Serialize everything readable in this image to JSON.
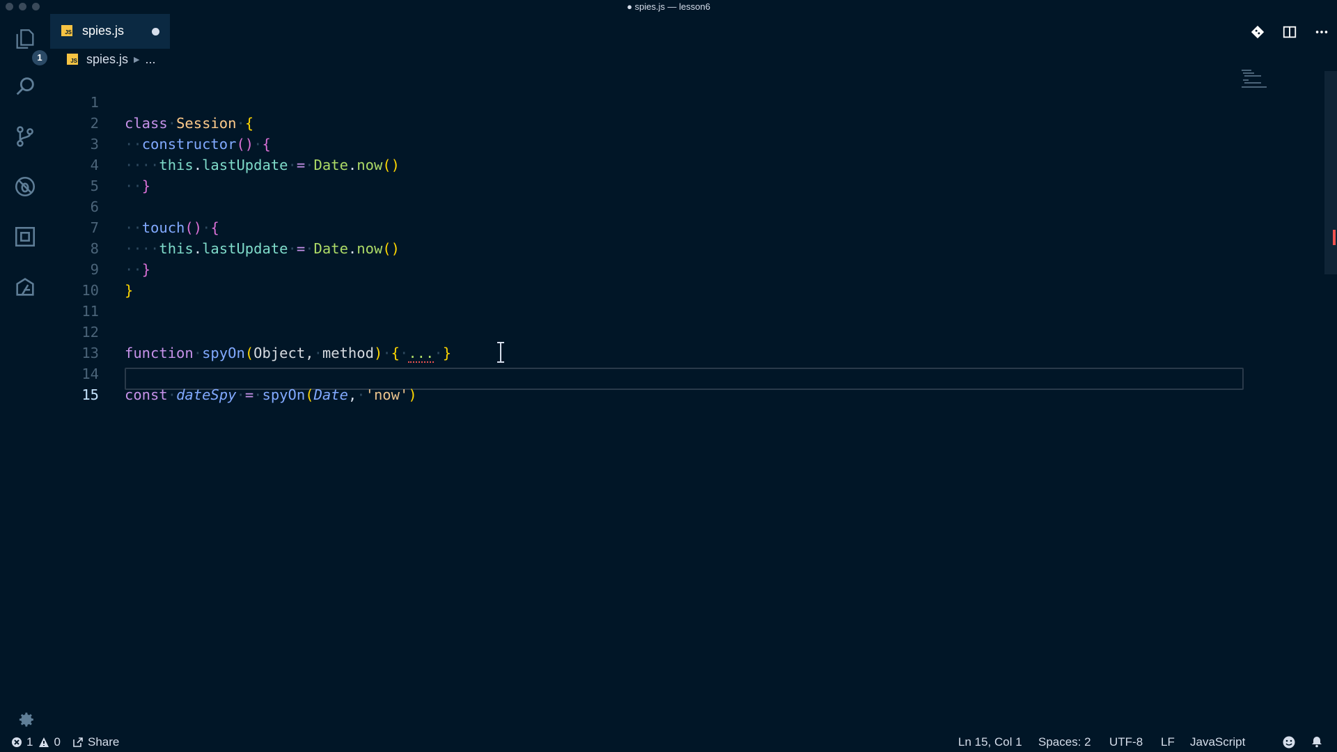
{
  "window": {
    "title": "● spies.js — lesson6"
  },
  "activity_bar": {
    "explorer_badge": "1",
    "items": [
      "explorer-icon",
      "search-icon",
      "source-control-icon",
      "debug-icon",
      "extensions-icon",
      "remote-icon"
    ]
  },
  "tabs": [
    {
      "label": "spies.js",
      "badge": "JS",
      "dirty": true
    }
  ],
  "breadcrumb": {
    "file": "spies.js",
    "symbol": "..."
  },
  "editor": {
    "line_numbers": [
      "1",
      "2",
      "3",
      "4",
      "5",
      "6",
      "7",
      "8",
      "9",
      "10",
      "11",
      "12",
      "13",
      "14",
      "15"
    ],
    "active_line": "15",
    "lines": [
      "class Session {",
      "  constructor() {",
      "    this.lastUpdate = Date.now()",
      "  }",
      "",
      "  touch() {",
      "    this.lastUpdate = Date.now()",
      "  }",
      "}",
      "",
      "",
      "function spyOn(Object, method) { ... }",
      "",
      "const dateSpy = spyOn(Date, 'now')",
      ""
    ]
  },
  "status_bar": {
    "errors": "1",
    "warnings": "0",
    "share": "Share",
    "cursor_position": "Ln 15, Col 1",
    "indentation": "Spaces: 2",
    "encoding": "UTF-8",
    "eol": "LF",
    "language": "JavaScript"
  }
}
